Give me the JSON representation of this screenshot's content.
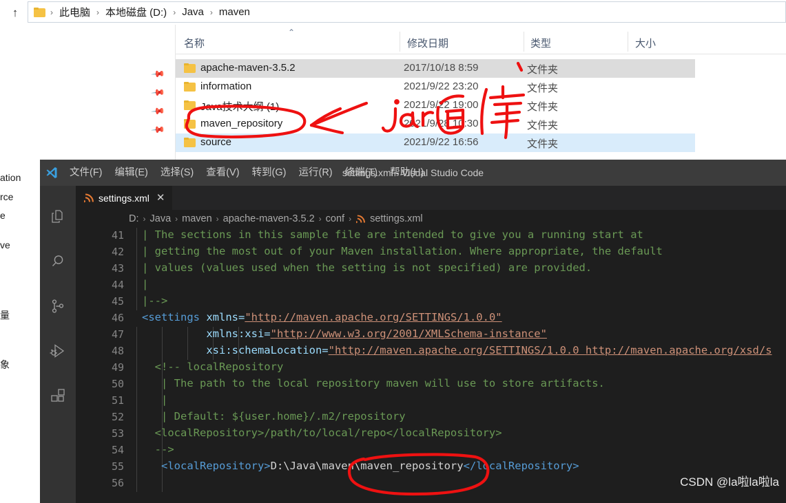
{
  "explorer": {
    "address_bar": {
      "up_icon": "up-arrow-icon",
      "folder_icon": "folder-icon",
      "crumbs": [
        "此电脑",
        "本地磁盘 (D:)",
        "Java",
        "maven"
      ],
      "separator": "›"
    },
    "columns": [
      {
        "label": "名称",
        "key": "name"
      },
      {
        "label": "修改日期",
        "key": "date"
      },
      {
        "label": "类型",
        "key": "type"
      },
      {
        "label": "大小",
        "key": "size"
      }
    ],
    "sort_caret": "⌃",
    "rows": [
      {
        "name": "apache-maven-3.5.2",
        "date": "2017/10/18 8:59",
        "type": "文件夹",
        "size": "",
        "state": "selected-grey"
      },
      {
        "name": "information",
        "date": "2021/9/22 23:20",
        "type": "文件夹",
        "size": "",
        "state": "normal"
      },
      {
        "name": "Java技术大纲 (1)",
        "date": "2021/9/22 19:00",
        "type": "文件夹",
        "size": "",
        "state": "normal"
      },
      {
        "name": "maven_repository",
        "date": "2021/9/28 10:30",
        "type": "文件夹",
        "size": "",
        "state": "normal"
      },
      {
        "name": "source",
        "date": "2021/9/22 16:56",
        "type": "文件夹",
        "size": "",
        "state": "hover-blue"
      }
    ],
    "pins": [
      "pin-icon",
      "pin-icon",
      "pin-icon",
      "pin-icon"
    ],
    "background_strip_text": [
      "ation",
      "rce",
      "e",
      "ve",
      "量",
      "象"
    ]
  },
  "vscode": {
    "window_title": "settings.xml - Visual Studio Code",
    "logo": "vscode-logo-icon",
    "menus": [
      "文件(F)",
      "编辑(E)",
      "选择(S)",
      "查看(V)",
      "转到(G)",
      "运行(R)",
      "终端(T)",
      "帮助(H)"
    ],
    "activity_bar": [
      {
        "name": "explorer-icon"
      },
      {
        "name": "search-icon"
      },
      {
        "name": "source-control-icon"
      },
      {
        "name": "run-and-debug-icon"
      },
      {
        "name": "extensions-icon"
      }
    ],
    "tab": {
      "label": "settings.xml",
      "icon": "xml-file-icon",
      "close": "✕"
    },
    "breadcrumb": {
      "items": [
        "D:",
        "Java",
        "maven",
        "apache-maven-3.5.2",
        "conf",
        "settings.xml"
      ],
      "separator": "›",
      "file_icon": "xml-file-icon"
    },
    "code": {
      "lines": [
        {
          "n": "41",
          "indent": 0,
          "guides": [
            0
          ],
          "segments": [
            {
              "t": "| The sections in this sample file are intended to give you a running start at",
              "c": "cmt"
            }
          ]
        },
        {
          "n": "42",
          "indent": 0,
          "guides": [
            0
          ],
          "segments": [
            {
              "t": "| getting the most out of your Maven installation. Where appropriate, the default",
              "c": "cmt"
            }
          ]
        },
        {
          "n": "43",
          "indent": 0,
          "guides": [
            0
          ],
          "segments": [
            {
              "t": "| values (values used when the setting is not specified) are provided.",
              "c": "cmt"
            }
          ]
        },
        {
          "n": "44",
          "indent": 0,
          "guides": [
            0
          ],
          "segments": [
            {
              "t": "|",
              "c": "cmt"
            }
          ]
        },
        {
          "n": "45",
          "indent": 0,
          "guides": [
            0
          ],
          "segments": [
            {
              "t": "|-->",
              "c": "cmt"
            }
          ]
        },
        {
          "n": "46",
          "indent": 0,
          "guides": [],
          "segments": [
            {
              "t": "<settings",
              "c": "tag"
            },
            {
              "t": " ",
              "c": "txt"
            },
            {
              "t": "xmlns=",
              "c": "attr"
            },
            {
              "t": "\"http://maven.apache.org/SETTINGS/1.0.0\"",
              "c": "link"
            }
          ]
        },
        {
          "n": "47",
          "indent": 0,
          "guides": [
            0,
            1,
            2,
            3,
            4
          ],
          "segments": [
            {
              "t": "          xmlns:xsi=",
              "c": "attr"
            },
            {
              "t": "\"http://www.w3.org/2001/XMLSchema-instance\"",
              "c": "link"
            }
          ]
        },
        {
          "n": "48",
          "indent": 0,
          "guides": [
            0,
            1,
            2,
            3,
            4
          ],
          "segments": [
            {
              "t": "          xsi:schemaLocation=",
              "c": "attr"
            },
            {
              "t": "\"http://maven.apache.org/SETTINGS/1.0.0 ",
              "c": "link"
            },
            {
              "t": "http://maven.apache.org/xsd/s",
              "c": "link"
            }
          ]
        },
        {
          "n": "49",
          "indent": 0,
          "guides": [
            0,
            1
          ],
          "segments": [
            {
              "t": "  <!-- localRepository",
              "c": "cmt"
            }
          ]
        },
        {
          "n": "50",
          "indent": 0,
          "guides": [
            0,
            1
          ],
          "segments": [
            {
              "t": "   | The path to the local repository maven will use to store artifacts.",
              "c": "cmt"
            }
          ]
        },
        {
          "n": "51",
          "indent": 0,
          "guides": [
            0,
            1
          ],
          "segments": [
            {
              "t": "   |",
              "c": "cmt"
            }
          ]
        },
        {
          "n": "52",
          "indent": 0,
          "guides": [
            0,
            1
          ],
          "segments": [
            {
              "t": "   | Default: ${user.home}/.m2/repository",
              "c": "cmt"
            }
          ]
        },
        {
          "n": "53",
          "indent": 0,
          "guides": [
            0,
            1
          ],
          "segments": [
            {
              "t": "  <localRepository>/path/to/local/repo</localRepository>",
              "c": "cmt"
            }
          ]
        },
        {
          "n": "54",
          "indent": 0,
          "guides": [
            0,
            1
          ],
          "segments": [
            {
              "t": "  -->",
              "c": "cmt"
            }
          ]
        },
        {
          "n": "55",
          "indent": 0,
          "guides": [
            0,
            1
          ],
          "segments": [
            {
              "t": "   ",
              "c": "txt"
            },
            {
              "t": "<localRepository>",
              "c": "tag"
            },
            {
              "t": "D:\\Java\\maven\\maven_repository",
              "c": "txt"
            },
            {
              "t": "</localRepository>",
              "c": "tag"
            }
          ]
        },
        {
          "n": "56",
          "indent": 0,
          "guides": [
            0,
            1
          ],
          "segments": [
            {
              "t": "",
              "c": "txt"
            }
          ]
        }
      ]
    }
  },
  "annotations": {
    "handwriting_text": "jar包库",
    "ink_color": "#ee1111",
    "circled_folder": "maven_repository",
    "circled_path": "D:\\Java\\maven\\maven_repository"
  },
  "watermark": {
    "text": "CSDN @la啦la啦la"
  },
  "colors": {
    "vscode_bg": "#1e1e1e",
    "vscode_titlebar": "#3c3c3c",
    "vscode_activitybar": "#333333",
    "vscode_tabbar": "#252526",
    "explorer_bg": "#ffffff",
    "row_selected": "#dcdcdc",
    "row_hover": "#d9ecfb",
    "ink": "#ee1111",
    "folder_yellow": "#f5c244"
  }
}
